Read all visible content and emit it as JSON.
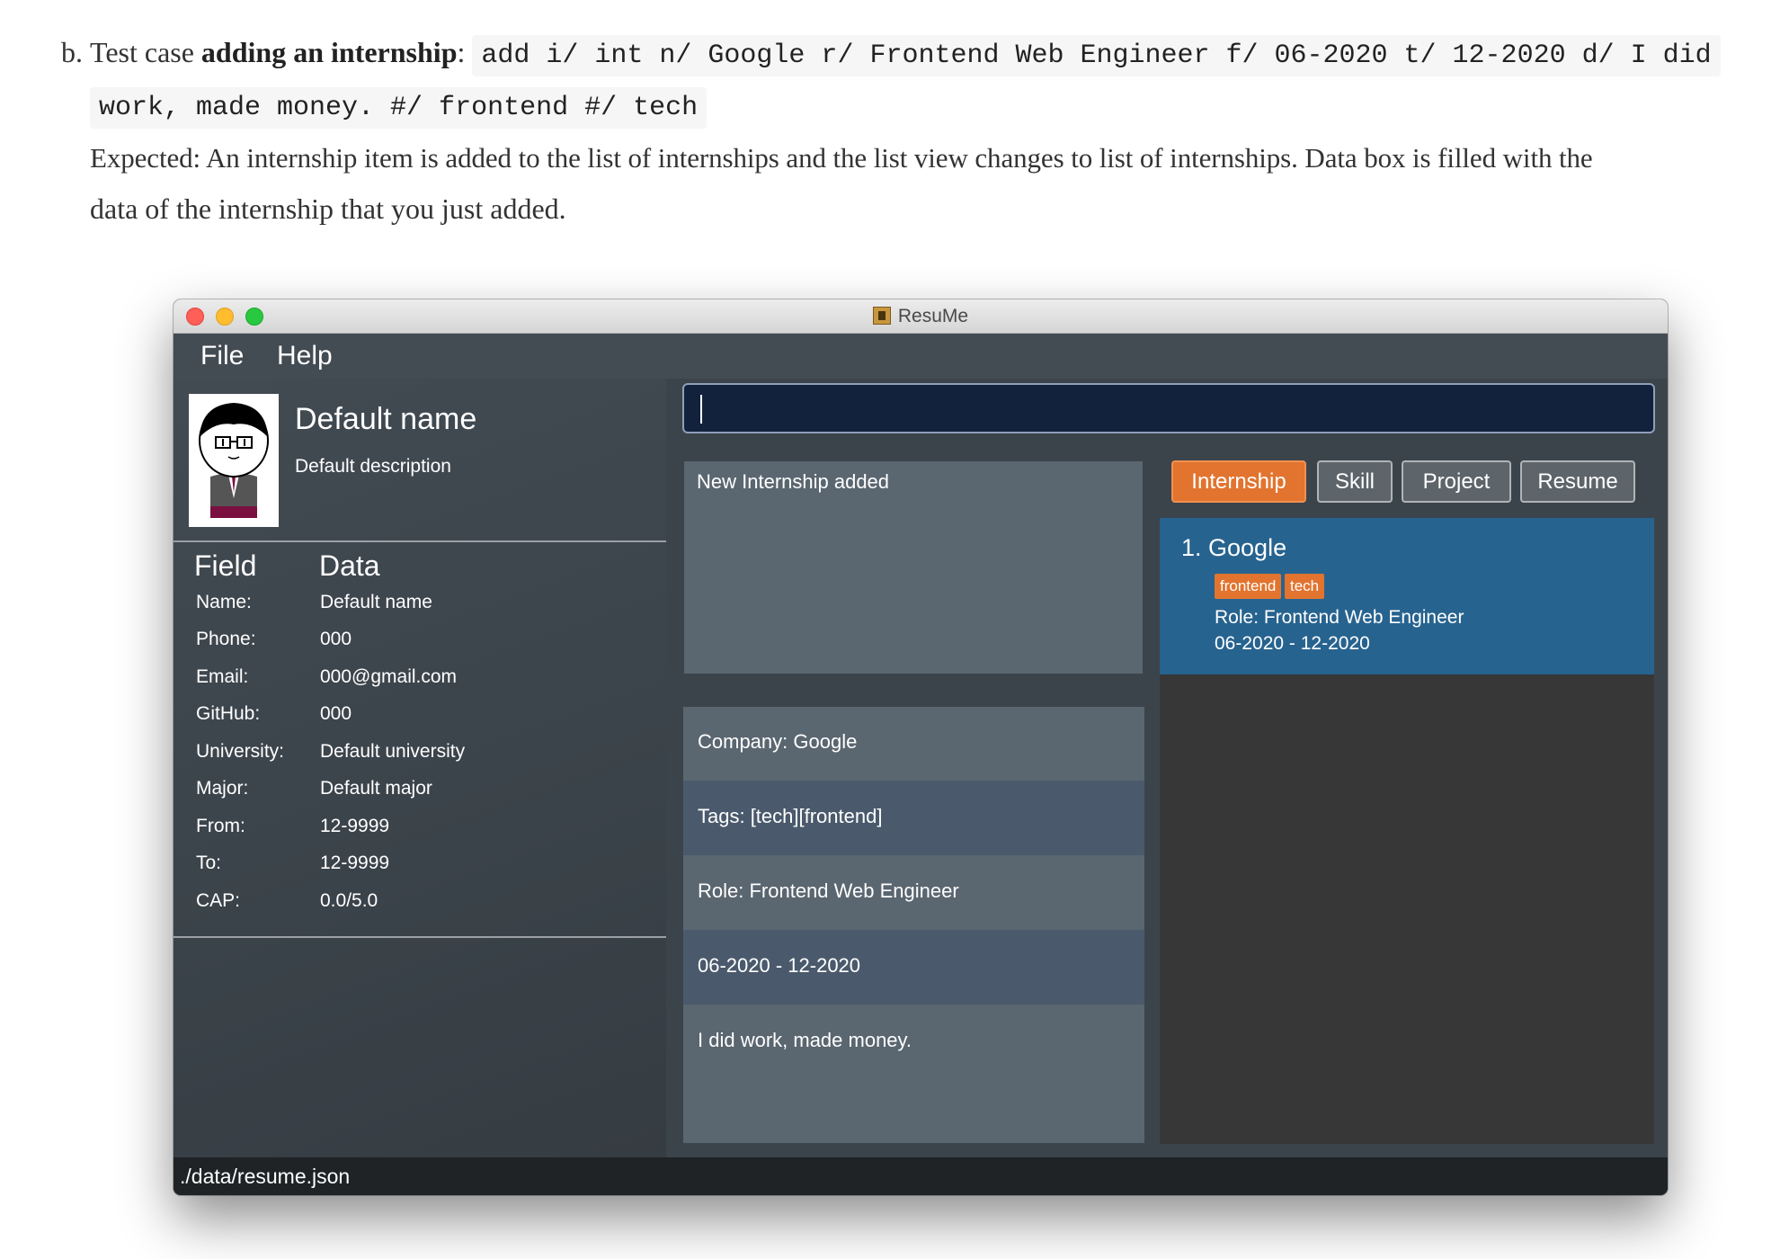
{
  "doc": {
    "marker": "b.",
    "lead": "Test case ",
    "bold": "adding an internship",
    "colon": ":",
    "code_line1": "add i/ int n/ Google r/ Frontend Web Engineer f/ 06-2020 t/ 12-2020 d/ I did",
    "code_line2": "work, made money. #/ frontend #/ tech",
    "expected_line1": "Expected: An internship item is added to the list of internships and the list view changes to list of internships. Data box is filled with the",
    "expected_line2": "data of the internship that you just added."
  },
  "window": {
    "title": "ResuMe",
    "menu": [
      "File",
      "Help"
    ],
    "profile": {
      "name": "Default name",
      "description": "Default description"
    },
    "fields_header": {
      "field": "Field",
      "data": "Data"
    },
    "fields": [
      {
        "key": "Name:",
        "value": "Default name"
      },
      {
        "key": "Phone:",
        "value": "000"
      },
      {
        "key": "Email:",
        "value": "000@gmail.com"
      },
      {
        "key": "GitHub:",
        "value": "000"
      },
      {
        "key": "University:",
        "value": "Default university"
      },
      {
        "key": "Major:",
        "value": "Default major"
      },
      {
        "key": "From:",
        "value": "12-9999"
      },
      {
        "key": "To:",
        "value": "12-9999"
      },
      {
        "key": "CAP:",
        "value": "0.0/5.0"
      }
    ],
    "command_value": "",
    "result_message": "New Internship added",
    "data_box": [
      "Company: Google",
      "Tags: [tech][frontend]",
      "Role: Frontend Web Engineer",
      "06-2020 - 12-2020",
      "I did work, made money."
    ],
    "tabs": [
      {
        "label": "Internship",
        "active": true
      },
      {
        "label": "Skill",
        "active": false
      },
      {
        "label": "Project",
        "active": false
      },
      {
        "label": "Resume",
        "active": false
      }
    ],
    "list": [
      {
        "title": "1.  Google",
        "tags": [
          "frontend",
          "tech"
        ],
        "role": "Role: Frontend Web Engineer",
        "dates": "06-2020 - 12-2020"
      }
    ],
    "status_path": "./data/resume.json"
  },
  "colors": {
    "accent_orange": "#e2742f",
    "selected_blue": "#27638f",
    "command_bg": "#12223d"
  }
}
